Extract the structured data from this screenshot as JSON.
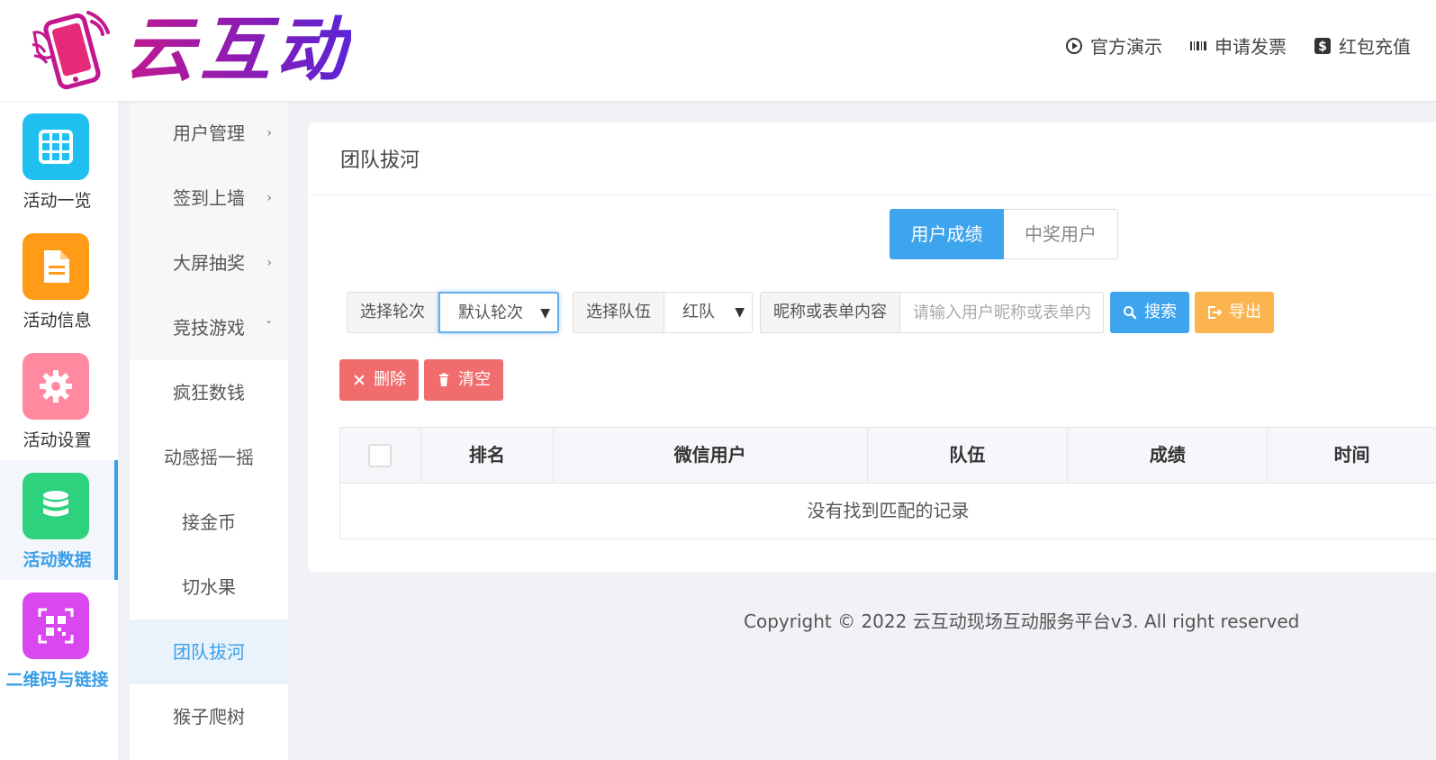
{
  "header": {
    "brand_name": "云互动",
    "links": [
      {
        "label": "官方演示",
        "icon": "play-circle-icon"
      },
      {
        "label": "申请发票",
        "icon": "barcode-icon"
      },
      {
        "label": "红包充值",
        "icon": "dollar-icon"
      }
    ]
  },
  "sidebar": {
    "items": [
      {
        "label": "活动一览",
        "icon": "grid-icon",
        "color": "#1fc0f0"
      },
      {
        "label": "活动信息",
        "icon": "document-icon",
        "color": "#ff9b17"
      },
      {
        "label": "活动设置",
        "icon": "gear-icon",
        "color": "#ff8aa0"
      },
      {
        "label": "活动数据",
        "icon": "database-icon",
        "color": "#2ed17e",
        "active": true
      },
      {
        "label": "二维码与链接",
        "icon": "qrcode-icon",
        "color": "#d948ee"
      }
    ]
  },
  "submenu": {
    "items": [
      {
        "label": "用户管理",
        "chevron": "›"
      },
      {
        "label": "签到上墙",
        "chevron": "›"
      },
      {
        "label": "大屏抽奖",
        "chevron": "›"
      },
      {
        "label": "竞技游戏",
        "chevron": "ˇ"
      },
      {
        "label": "疯狂数钱"
      },
      {
        "label": "动感摇一摇"
      },
      {
        "label": "接金币"
      },
      {
        "label": "切水果"
      },
      {
        "label": "团队拔河",
        "active": true
      },
      {
        "label": "猴子爬树"
      }
    ]
  },
  "panel": {
    "title": "团队拔河",
    "tabs": [
      {
        "label": "用户成绩",
        "active": true
      },
      {
        "label": "中奖用户"
      }
    ],
    "filters": {
      "round_label": "选择轮次",
      "round_value": "默认轮次",
      "team_label": "选择队伍",
      "team_value": "红队",
      "keyword_label": "昵称或表单内容",
      "keyword_placeholder": "请输入用户昵称或表单内容",
      "keyword_value": "",
      "search_button": "搜索",
      "export_button": "导出"
    },
    "actions": {
      "delete_button": "删除",
      "clear_button": "清空"
    },
    "table": {
      "columns": [
        "排名",
        "微信用户",
        "队伍",
        "成绩",
        "时间"
      ],
      "empty_text": "没有找到匹配的记录"
    }
  },
  "footer": {
    "copyright": "Copyright © 2022 云互动现场互动服务平台v3. All right reserved"
  }
}
